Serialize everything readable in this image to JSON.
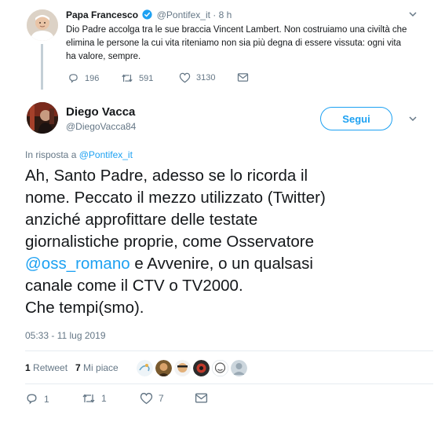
{
  "parent_tweet": {
    "author_name": "Papa Francesco",
    "author_handle": "@Pontifex_it",
    "separator": "·",
    "time": "8 h",
    "text": "Dio Padre accolga tra le sue braccia Vincent Lambert. Non costruiamo una civiltà che elimina le persone la cui vita riteniamo non sia più degna di essere vissuta: ogni vita ha valore, sempre.",
    "replies": "196",
    "retweets": "591",
    "likes": "3130"
  },
  "tweet": {
    "author_name": "Diego Vacca",
    "author_handle": "@DiegoVacca84",
    "follow_label": "Segui",
    "reply_prefix": "In risposta a ",
    "reply_target": "@Pontifex_it",
    "lines": [
      "Ah, Santo Padre, adesso se lo ricorda il",
      "nome. Peccato il mezzo utilizzato (Twitter)",
      "anziché approfittare delle testate",
      "giornalistiche proprie, come Osservatore"
    ],
    "mention": "@oss_romano",
    "line5_rest": " e Avvenire, o un qualsasi",
    "lines_end": [
      "canale come il CTV o TV2000.",
      "Che tempi(smo)."
    ],
    "timestamp": "05:33 - 11 lug 2019",
    "retweet_count": "1",
    "retweet_label": "Retweet",
    "like_count": "7",
    "like_label": "Mi piace",
    "actions": {
      "replies": "1",
      "retweets": "1",
      "likes": "7"
    }
  },
  "colors": {
    "accent": "#1da1f2",
    "text": "#14171a",
    "secondary": "#657786",
    "divider": "#e6ecf0"
  }
}
